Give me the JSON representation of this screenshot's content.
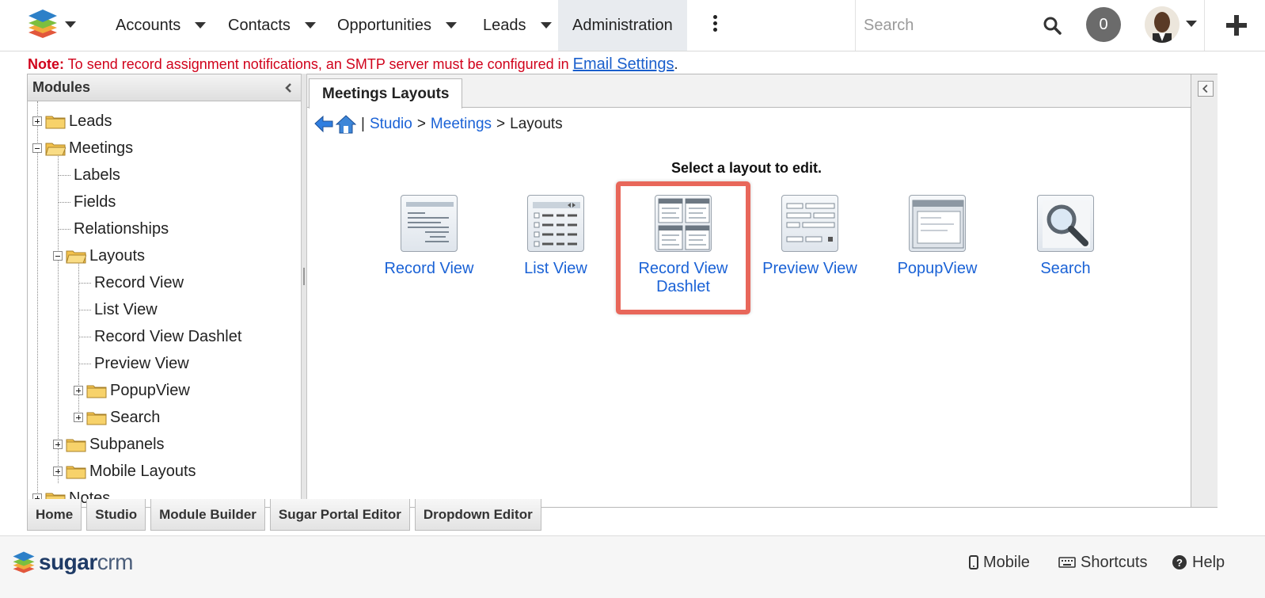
{
  "topnav": {
    "items": [
      {
        "label": "Accounts"
      },
      {
        "label": "Contacts"
      },
      {
        "label": "Opportunities"
      },
      {
        "label": "Leads"
      }
    ],
    "active_label": "Administration",
    "search_placeholder": "Search",
    "notification_count": "0",
    "icons": [
      "sugar-logo-icon",
      "kebab-menu-icon",
      "search-icon",
      "avatar",
      "plus-icon"
    ]
  },
  "note": {
    "prefix": "Note:",
    "message": " To send record assignment notifications, an SMTP server must be configured in ",
    "link": "Email Settings",
    "suffix": "."
  },
  "modules_panel": {
    "title": "Modules",
    "tree": [
      {
        "label": "Leads",
        "kind": "folder",
        "state": "collapsed"
      },
      {
        "label": "Meetings",
        "kind": "folder",
        "state": "expanded"
      },
      {
        "label": "Labels",
        "kind": "leaf"
      },
      {
        "label": "Fields",
        "kind": "leaf"
      },
      {
        "label": "Relationships",
        "kind": "leaf"
      },
      {
        "label": "Layouts",
        "kind": "folder",
        "state": "expanded"
      },
      {
        "label": "Record View",
        "kind": "leaf"
      },
      {
        "label": "List View",
        "kind": "leaf"
      },
      {
        "label": "Record View Dashlet",
        "kind": "leaf"
      },
      {
        "label": "Preview View",
        "kind": "leaf"
      },
      {
        "label": "PopupView",
        "kind": "folder",
        "state": "collapsed"
      },
      {
        "label": "Search",
        "kind": "folder",
        "state": "collapsed"
      },
      {
        "label": "Subpanels",
        "kind": "folder",
        "state": "collapsed"
      },
      {
        "label": "Mobile Layouts",
        "kind": "folder",
        "state": "collapsed"
      },
      {
        "label": "Notes",
        "kind": "folder",
        "state": "collapsed"
      }
    ]
  },
  "main": {
    "tab_title": "Meetings Layouts",
    "breadcrumb": {
      "sep1": "|",
      "studio": "Studio",
      "arrow1": ">",
      "module": "Meetings",
      "arrow2": ">",
      "current": "Layouts"
    },
    "prompt": "Select a layout to edit.",
    "layouts": [
      {
        "label": "Record View",
        "icon": "record-view-icon"
      },
      {
        "label": "List View",
        "icon": "list-view-icon"
      },
      {
        "label": "Record View Dashlet",
        "icon": "dashlet-icon",
        "highlighted": true
      },
      {
        "label": "Preview View",
        "icon": "preview-view-icon"
      },
      {
        "label": "PopupView",
        "icon": "popup-view-icon"
      },
      {
        "label": "Search",
        "icon": "magnifier-icon"
      }
    ],
    "highlight_color": "#e8675a"
  },
  "bottom_tabs": [
    "Home",
    "Studio",
    "Module Builder",
    "Sugar Portal Editor",
    "Dropdown Editor"
  ],
  "footer": {
    "brand_bold": "sugar",
    "brand_light": "crm",
    "links": {
      "mobile": "Mobile",
      "shortcuts": "Shortcuts",
      "help": "Help"
    }
  },
  "colors": {
    "link": "#1a62d6",
    "note": "#d0021b",
    "active_nav": "#e8ebef"
  }
}
